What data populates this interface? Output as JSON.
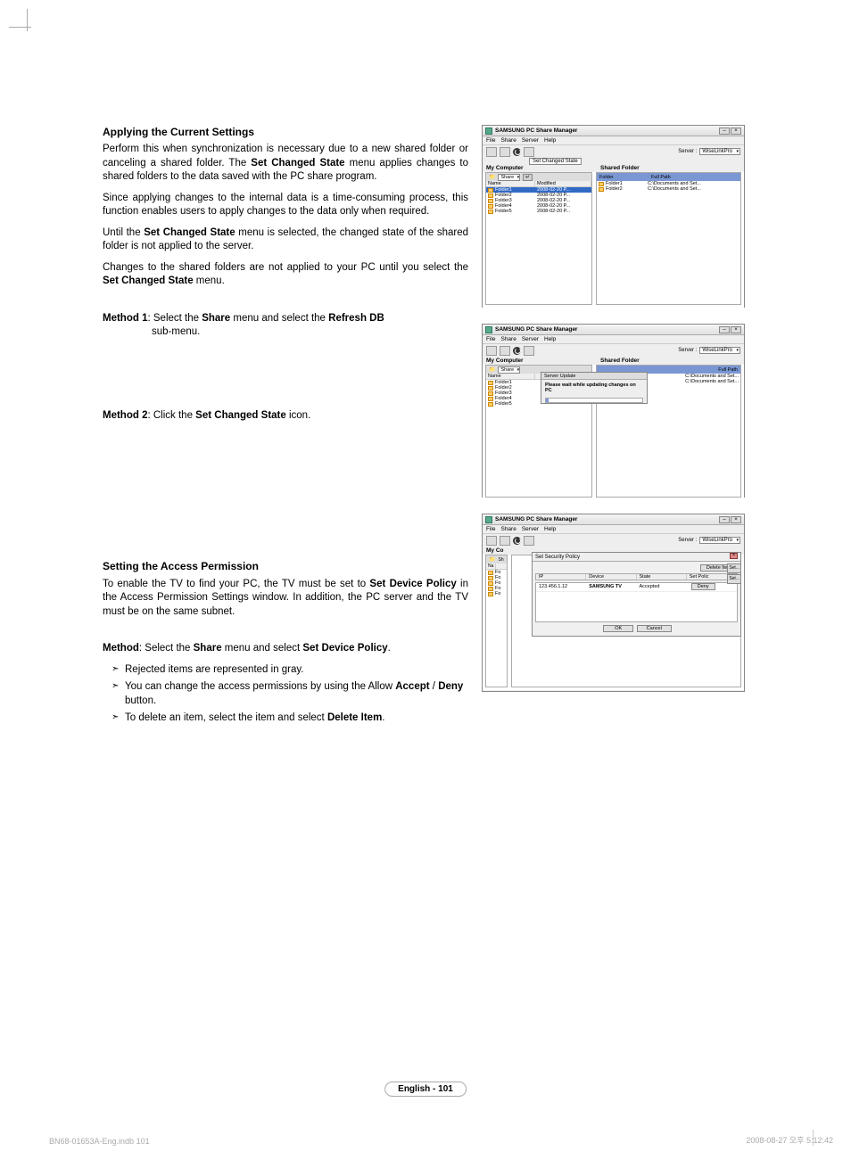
{
  "section1": {
    "heading": "Applying the Current Settings",
    "p1_a": "Perform this when synchronization is necessary due to a new shared folder or canceling a shared folder. The ",
    "p1_b": "Set Changed State",
    "p1_c": " menu applies changes to shared folders to the data saved with the PC share program.",
    "p2": "Since applying changes to the internal data is a time-consuming process, this function enables users to apply changes to the data only when required.",
    "p3_a": "Until the ",
    "p3_b": "Set Changed State",
    "p3_c": " menu is selected, the changed state of the shared folder is not applied to the server.",
    "p4_a": " Changes to the shared folders are not applied to your PC until you select the ",
    "p4_b": "Set Changed State",
    "p4_c": " menu.",
    "m1_a": "Method 1",
    "m1_b": ": Select the ",
    "m1_c": "Share",
    "m1_d": " menu and select the ",
    "m1_e": "Refresh DB",
    "m1_sub": "sub-menu.",
    "m2_a": "Method 2",
    "m2_b": ": Click the ",
    "m2_c": "Set Changed State",
    "m2_d": " icon."
  },
  "section2": {
    "heading": "Setting the Access Permission",
    "p1_a": "To enable the TV to find your PC, the TV must be set to ",
    "p1_b": "Set Device Policy",
    "p1_c": " in the Access Permission Settings window. In addition, the PC server and the TV must be on the same subnet.",
    "m_a": "Method",
    "m_b": ": Select the ",
    "m_c": "Share",
    "m_d": " menu and select ",
    "m_e": "Set Device Policy",
    "m_f": ".",
    "b1": "Rejected items are represented in gray.",
    "b2_a": "You can change the access permissions by using the Allow ",
    "b2_b": "Accept",
    "b2_c": " / ",
    "b2_d": "Deny",
    "b2_e": " button.",
    "b3_a": "To delete an item, select the item and select ",
    "b3_b": "Delete Item",
    "b3_c": "."
  },
  "win": {
    "title": "SAMSUNG PC Share Manager",
    "menu_file": "File",
    "menu_share": "Share",
    "menu_server": "Server",
    "menu_help": "Help",
    "set_changed": "Set Changed State",
    "server_lbl": "Server :",
    "server_val": "WiseLinkPro",
    "myc": "My Computer",
    "sf": "Shared Folder",
    "share_lbl": "Share",
    "col_name": "Name",
    "col_mod": "Modified",
    "col_folder": "Folder",
    "col_path": "Full Path",
    "folders": [
      {
        "name": "Folder1",
        "date": "2008-02-20 P..."
      },
      {
        "name": "Folder2",
        "date": "2008-02-20 P..."
      },
      {
        "name": "Folder3",
        "date": "2008-02-20 P..."
      },
      {
        "name": "Folder4",
        "date": "2008-02-20 P..."
      },
      {
        "name": "Folder5",
        "date": "2008-02-20 P..."
      }
    ],
    "shared_rows": [
      {
        "name": "Folder1",
        "path": "C:\\Documents and Set..."
      },
      {
        "name": "Folder2",
        "path": "C:\\Documents and Set..."
      }
    ]
  },
  "progress": {
    "title": "Server Update",
    "msg": "Please wait while updating changes on PC"
  },
  "policy": {
    "title": "Set Security Policy",
    "delete": "Delete Item",
    "h_ip": "IP",
    "h_dev": "Device",
    "h_state": "State",
    "h_setpol": "Set Polic",
    "row_ip": "123.456.1.12",
    "row_dev": "SAMSUNG TV",
    "row_state": "Accepted",
    "deny": "Deny",
    "side_set": "Set...",
    "ok": "OK",
    "cancel": "Cancel"
  },
  "footer": {
    "pill": "English - 101",
    "left": "BN68-01653A-Eng.indb   101",
    "right": "2008-08-27   오후 5:12:42"
  }
}
